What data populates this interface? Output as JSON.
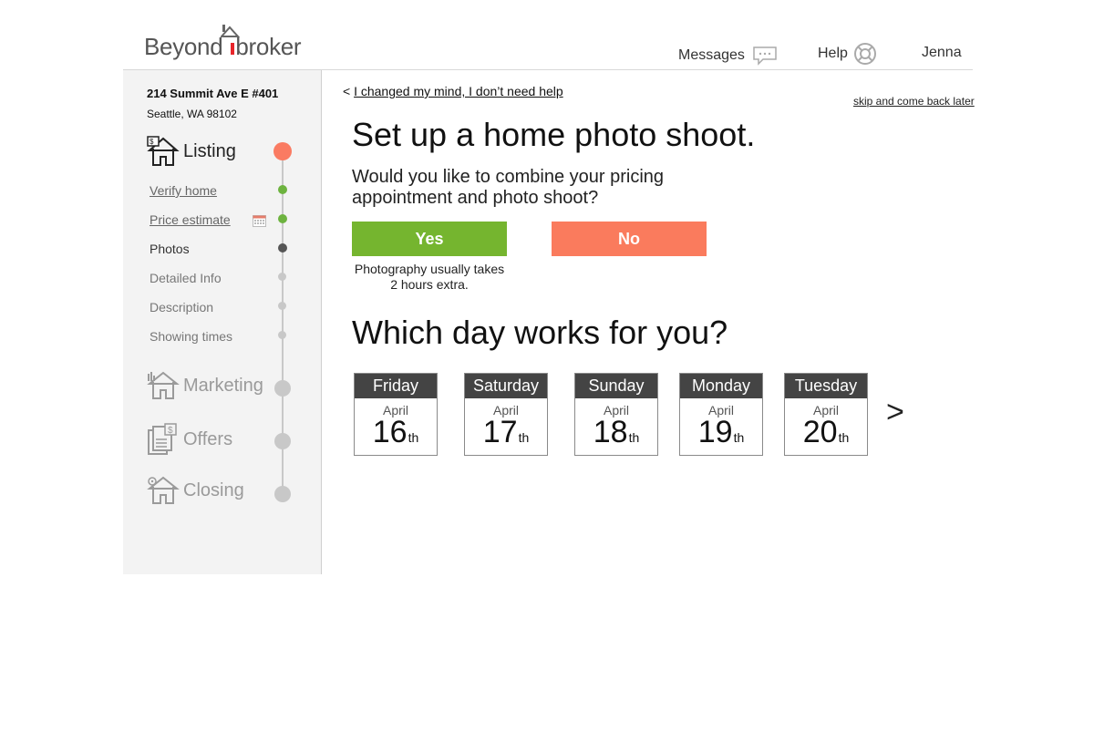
{
  "brand": {
    "part1": "Beyond",
    "part2": "broker"
  },
  "header": {
    "messages_label": "Messages",
    "help_label": "Help",
    "user_name": "Jenna"
  },
  "sidebar": {
    "address_line1": "214 Summit Ave E #401",
    "address_line2": "Seattle, WA 98102",
    "sections": [
      {
        "label": "Listing",
        "state": "active"
      },
      {
        "label": "Marketing",
        "state": "inactive"
      },
      {
        "label": "Offers",
        "state": "inactive"
      },
      {
        "label": "Closing",
        "state": "inactive"
      }
    ],
    "steps": [
      {
        "label": "Verify home",
        "status": "done"
      },
      {
        "label": "Price estimate",
        "status": "done"
      },
      {
        "label": "Photos",
        "status": "current"
      },
      {
        "label": "Detailed Info",
        "status": "todo"
      },
      {
        "label": "Description",
        "status": "todo"
      },
      {
        "label": "Showing times",
        "status": "todo"
      }
    ]
  },
  "main": {
    "back_prefix": "<",
    "back_link": "I changed my mind, I don’t need help",
    "skip_link": "skip and come back later",
    "title": "Set up a home photo shoot.",
    "question": "Would you like to combine your pricing appointment and photo shoot?",
    "yes_label": "Yes",
    "no_label": "No",
    "note": "Photography usually takes 2 hours extra.",
    "days_title": "Which day works for you?",
    "days": [
      {
        "weekday": "Friday",
        "month": "April",
        "day": "16",
        "suffix": "th"
      },
      {
        "weekday": "Saturday",
        "month": "April",
        "day": "17",
        "suffix": "th"
      },
      {
        "weekday": "Sunday",
        "month": "April",
        "day": "18",
        "suffix": "th"
      },
      {
        "weekday": "Monday",
        "month": "April",
        "day": "19",
        "suffix": "th"
      },
      {
        "weekday": "Tuesday",
        "month": "April",
        "day": "20",
        "suffix": "th"
      }
    ],
    "next_label": ">"
  },
  "colors": {
    "accent_orange": "#fa7b5d",
    "accent_green": "#75b52f",
    "day_header": "#444444"
  }
}
